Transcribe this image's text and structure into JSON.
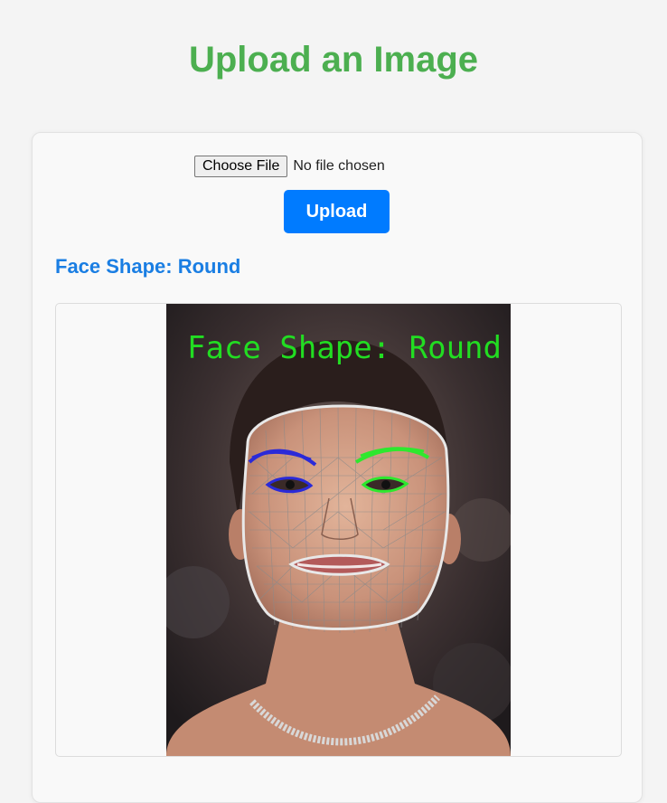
{
  "header": {
    "title": "Upload an Image"
  },
  "upload_form": {
    "file_button_label": "Choose File",
    "file_status": "No file chosen",
    "upload_label": "Upload"
  },
  "result": {
    "heading": "Face Shape: Round",
    "overlay_text": "Face Shape: Round",
    "colors": {
      "left_features": "#2a2ad8",
      "right_features": "#2ee82e",
      "overlay_text": "#22dd22",
      "mesh": "#8a8a8a",
      "outline": "#e8e8e8"
    }
  },
  "colors": {
    "title": "#4caf50",
    "upload_button": "#007bff",
    "result_heading": "#1a7ee3"
  }
}
